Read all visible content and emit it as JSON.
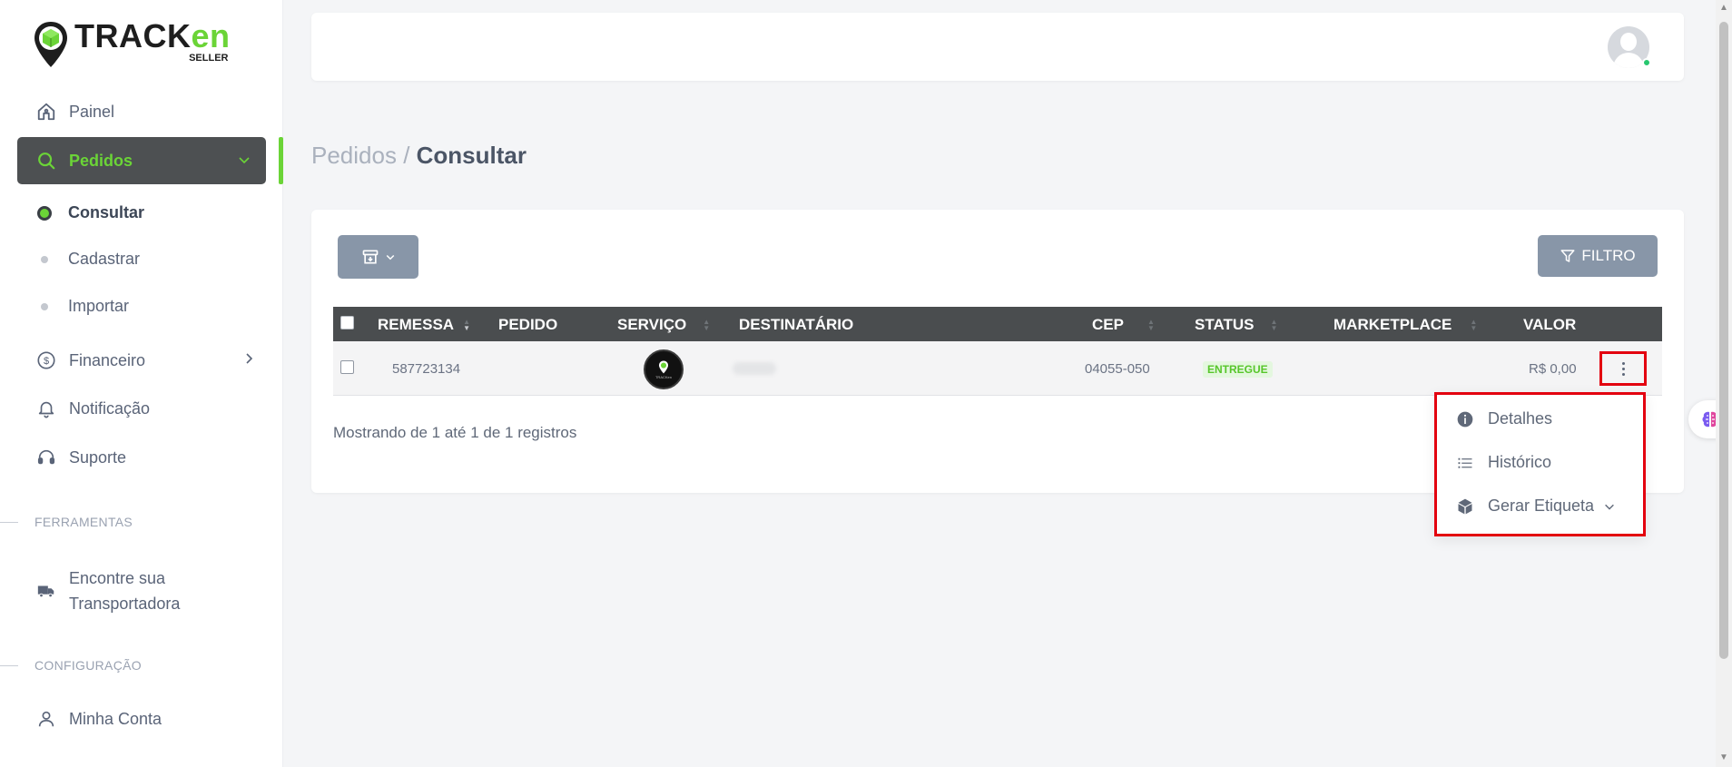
{
  "brand": {
    "name_part1": "TRACK",
    "name_part2": "en",
    "subtitle": "SELLER",
    "accent_color": "#6bd437"
  },
  "sidebar": {
    "items": [
      {
        "label": "Painel",
        "icon": "home-icon"
      },
      {
        "label": "Pedidos",
        "icon": "search-icon",
        "active": true
      },
      {
        "label": "Financeiro",
        "icon": "dollar-circle-icon"
      },
      {
        "label": "Notificação",
        "icon": "bell-icon"
      },
      {
        "label": "Suporte",
        "icon": "headset-icon"
      },
      {
        "label": "Encontre sua Transportadora",
        "line1": "Encontre sua",
        "line2": "Transportadora",
        "icon": "truck-icon"
      },
      {
        "label": "Minha Conta",
        "icon": "user-icon"
      }
    ],
    "subitems": [
      {
        "label": "Consultar",
        "current": true
      },
      {
        "label": "Cadastrar"
      },
      {
        "label": "Importar"
      }
    ],
    "sections": {
      "tools": "FERRAMENTAS",
      "config": "CONFIGURAÇÃO"
    }
  },
  "breadcrumb": {
    "parent": "Pedidos",
    "separator": " / ",
    "current": "Consultar"
  },
  "toolbar": {
    "filter_label": "FILTRO"
  },
  "table": {
    "columns": [
      "REMESSA",
      "PEDIDO",
      "SERVIÇO",
      "DESTINATÁRIO",
      "CEP",
      "STATUS",
      "MARKETPLACE",
      "VALOR"
    ],
    "rows": [
      {
        "remessa": "587723134",
        "pedido": "",
        "servico_logo": "TRACKen",
        "destinatario": "",
        "cep": "04055-050",
        "status": "ENTREGUE",
        "marketplace": "",
        "valor": "R$ 0,00"
      }
    ]
  },
  "footer": {
    "showing": "Mostrando de 1 até 1 de 1 registros"
  },
  "row_menu": {
    "items": [
      {
        "label": "Detalhes",
        "icon": "info-circle-icon"
      },
      {
        "label": "Histórico",
        "icon": "list-icon"
      },
      {
        "label": "Gerar Etiqueta",
        "icon": "box-icon"
      }
    ]
  },
  "colors": {
    "status_green": "#57c62a",
    "highlight_red": "#e3000f",
    "header_dark": "#4a4d4f"
  }
}
